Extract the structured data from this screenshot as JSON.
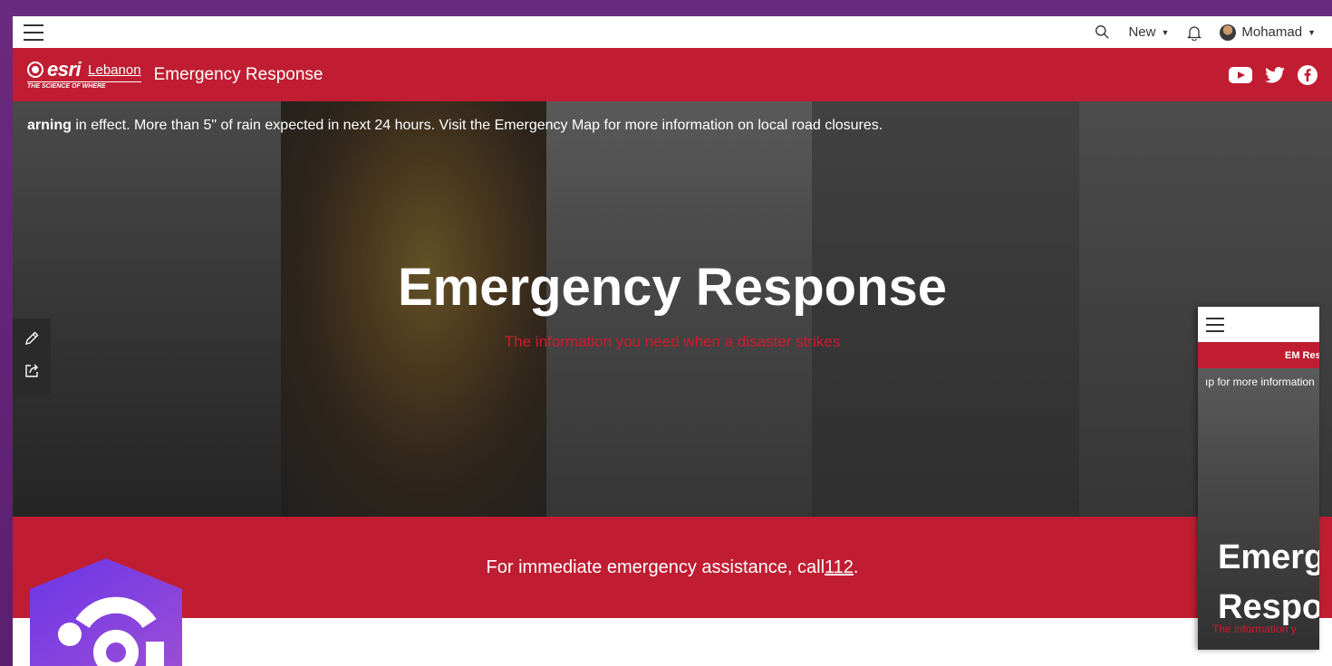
{
  "topbar": {
    "new_label": "New",
    "user_name": "Mohamad"
  },
  "header": {
    "logo_esri": "esri",
    "logo_country": "Lebanon",
    "logo_tagline": "THE SCIENCE OF WHERE",
    "site_title": "Emergency Response"
  },
  "hero": {
    "ticker_bold": "arning",
    "ticker_text": " in effect. More than 5\" of rain expected in next 24 hours. Visit the Emergency Map for more information on local road closures.",
    "title": "Emergency Response",
    "subtitle": "The information you need when a disaster strikes"
  },
  "band": {
    "prefix": "For immediate emergency assistance, call ",
    "number": "112",
    "suffix": "."
  },
  "preview": {
    "header_label": "EM Respo",
    "ticker": "ıp for more information",
    "title_line1": "Emerg",
    "title_line2": "Respo",
    "subtitle": "The information y"
  },
  "colors": {
    "brand_red": "#c01d32",
    "subtitle_red": "#d3192e",
    "outer_purple": "#6a2a7e"
  },
  "icons": [
    "menu-icon",
    "search-icon",
    "bell-icon",
    "youtube-icon",
    "twitter-icon",
    "facebook-icon",
    "edit-icon",
    "share-icon"
  ]
}
